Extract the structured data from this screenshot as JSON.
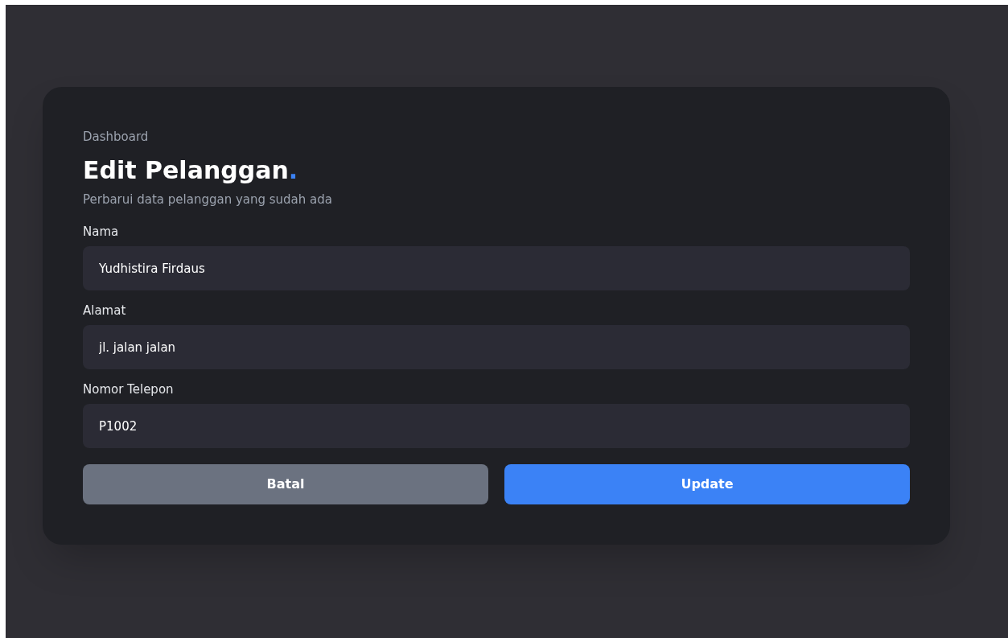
{
  "breadcrumb": "Dashboard",
  "title": {
    "text": "Edit Pelanggan",
    "accent": "."
  },
  "subtitle": "Perbarui data pelanggan yang sudah ada",
  "fields": [
    {
      "label": "Nama",
      "value": "Yudhistira Firdaus"
    },
    {
      "label": "Alamat",
      "value": "jl. jalan jalan"
    },
    {
      "label": "Nomor Telepon",
      "value": "P1002"
    }
  ],
  "buttons": [
    {
      "label": "Batal",
      "kind": "secondary"
    },
    {
      "label": "Update",
      "kind": "primary"
    }
  ]
}
